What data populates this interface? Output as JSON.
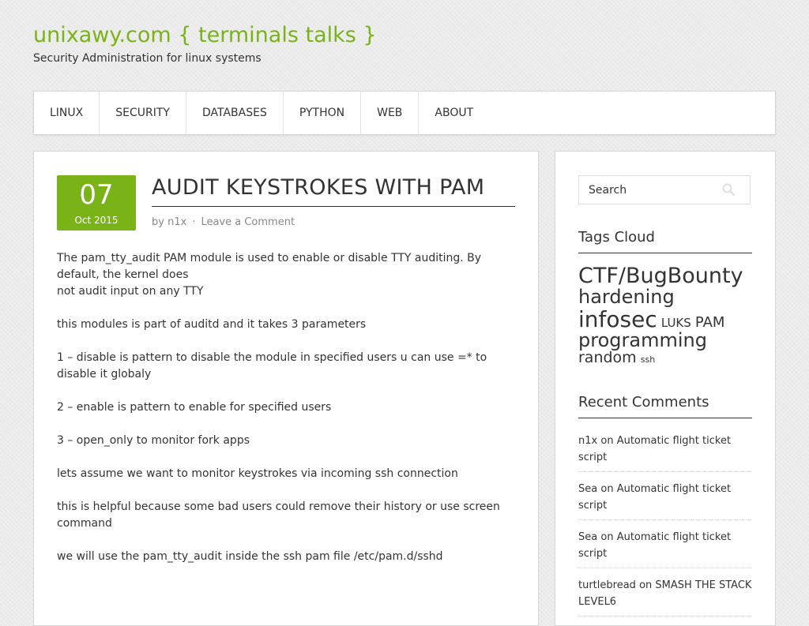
{
  "site": {
    "title": "unixawy.com { terminals talks }",
    "description": "Security Administration for linux systems"
  },
  "nav": [
    {
      "label": "LINUX"
    },
    {
      "label": "SECURITY"
    },
    {
      "label": "DATABASES"
    },
    {
      "label": "PYTHON"
    },
    {
      "label": "WEB"
    },
    {
      "label": "ABOUT"
    }
  ],
  "post": {
    "day": "07",
    "month": "Oct 2015",
    "title": "AUDIT KEYSTROKES WITH PAM",
    "meta": {
      "by": "by",
      "author": "n1x",
      "separator": "·",
      "comment_link": "Leave a Comment"
    },
    "paragraphs": [
      [
        "The pam_tty_audit PAM module is used to enable or disable TTY auditing. By default, the kernel does",
        "not audit input on any TTY"
      ],
      [
        "this modules is part of auditd and it takes  3 parameters"
      ],
      [
        "1 – disable  is pattern to disable the module in specified users u can use =* to disable it globaly"
      ],
      [
        "2 – enable  is pattern to enable for specified users"
      ],
      [
        "3 – open_only to monitor fork apps"
      ],
      [
        "lets assume we want to monitor keystrokes via incoming ssh connection"
      ],
      [
        "this is helpful because some bad users could remove their history or use screen command"
      ],
      [
        "we will use the pam_tty_audit inside the ssh pam file /etc/pam.d/sshd"
      ]
    ]
  },
  "sidebar": {
    "search": {
      "placeholder": "Search",
      "value": "",
      "icon": "search-icon"
    },
    "tags_title": "Tags Cloud",
    "tags": [
      {
        "label": "CTF/BugBounty"
      },
      {
        "label": "hardening"
      },
      {
        "label": "infosec"
      },
      {
        "label": "LUKS"
      },
      {
        "label": "PAM"
      },
      {
        "label": "programming"
      },
      {
        "label": "random"
      },
      {
        "label": "ssh"
      }
    ],
    "comments_title": "Recent Comments",
    "comments": [
      {
        "author": "n1x",
        "on": "on",
        "post": "Automatic flight ticket script"
      },
      {
        "author": "Sea",
        "on": "on",
        "post": "Automatic flight ticket script"
      },
      {
        "author": "Sea",
        "on": "on",
        "post": "Automatic flight ticket script"
      },
      {
        "author": "turtlebread",
        "on": "on",
        "post": "SMASH THE STACK LEVEL6"
      }
    ]
  },
  "colors": {
    "accent": "#7ab317",
    "text": "#333333",
    "meta": "#888888"
  }
}
